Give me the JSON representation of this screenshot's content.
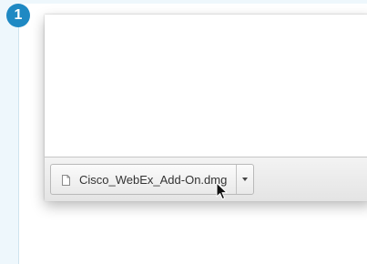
{
  "step": {
    "number": "1"
  },
  "downloads_bar": {
    "items": [
      {
        "filename": "Cisco_WebEx_Add-On.dmg",
        "menu_icon": "chevron-down-icon",
        "file_icon": "file-icon"
      }
    ]
  },
  "colors": {
    "accent": "#1f89c3",
    "panel_bg": "#eef7fc"
  }
}
